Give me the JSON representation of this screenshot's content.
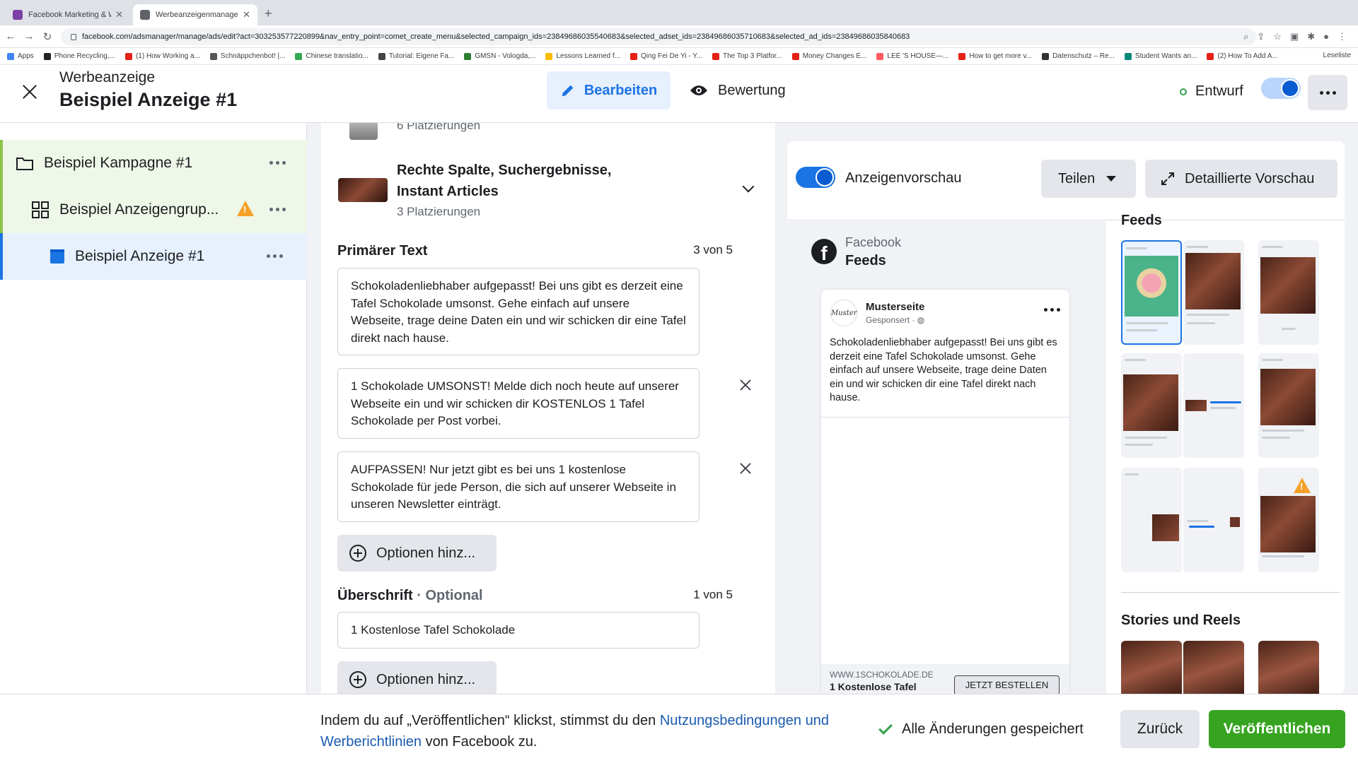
{
  "browser": {
    "tabs": [
      {
        "label": "Facebook Marketing & Werbe…"
      },
      {
        "label": "Werbeanzeigenmanager - We…"
      }
    ],
    "url": "facebook.com/adsmanager/manage/ads/edit?act=303253577220899&nav_entry_point=comet_create_menu&selected_campaign_ids=23849686035540683&selected_adset_ids=23849686035710683&selected_ad_ids=23849686035840683",
    "bookmarks": [
      "Apps",
      "Phone Recycling,...",
      "(1) How Working a...",
      "Schnäppchenbot! |...",
      "Chinese translatio...",
      "Tutorial: Eigene Fa...",
      "GMSN - Vologda,...",
      "Lessons Learned f...",
      "Qing Fei De Yi - Y...",
      "The Top 3 Platfor...",
      "Money Changes E...",
      "LEE 'S HOUSE—...",
      "How to get more v...",
      "Datenschutz – Re...",
      "Student Wants an...",
      "(2) How To Add A..."
    ],
    "reading_list": "Leseliste"
  },
  "header": {
    "subtitle": "Werbeanzeige",
    "title": "Beispiel Anzeige #1",
    "edit_label": "Bearbeiten",
    "review_label": "Bewertung",
    "status_label": "Entwurf"
  },
  "tree": {
    "campaign": "Beispiel Kampagne #1",
    "adset": "Beispiel Anzeigengrup...",
    "ad": "Beispiel Anzeige #1"
  },
  "editor": {
    "placement1_count": "6 Platzierungen",
    "placement2_title_line1": "Rechte Spalte, Suchergebnisse,",
    "placement2_title_line2": "Instant Articles",
    "placement2_count": "3 Platzierungen",
    "primary_title": "Primärer Text",
    "primary_count": "3 von 5",
    "primary_texts": [
      "Schokoladenliebhaber aufgepasst! Bei uns gibt es derzeit eine Tafel Schokolade umsonst. Gehe einfach auf unsere Webseite, trage deine Daten ein und wir schicken dir eine Tafel direkt nach hause.",
      "1 Schokolade UMSONST! Melde dich noch heute auf unserer Webseite ein und wir schicken dir KOSTENLOS 1 Tafel Schokolade per Post vorbei.",
      "AUFPASSEN! Nur jetzt gibt es bei uns 1 kostenlose Schokolade für jede Person, die sich auf unserer Webseite in unseren Newsletter einträgt."
    ],
    "add_options_label": "Optionen hinz...",
    "headline_title": "Überschrift",
    "headline_optional": "· Optional",
    "headline_count": "1 von 5",
    "headline_value": "1 Kostenlose Tafel Schokolade"
  },
  "preview": {
    "toggle_label": "Anzeigenvorschau",
    "share_label": "Teilen",
    "detailed_label": "Detaillierte Vorschau",
    "platform": "Facebook",
    "placement": "Feeds",
    "page_name": "Musterseite",
    "sponsored": "Gesponsert ·",
    "avatar_text": "Muster",
    "post_text": "Schokoladenliebhaber aufgepasst! Bei uns gibt es derzeit eine Tafel Schokolade umsonst. Gehe einfach auf unsere Webseite, trage deine Daten ein und wir schicken dir eine Tafel direkt nach hause.",
    "link_url": "WWW.1SCHOKOLADE.DE",
    "link_headline": "1 Kostenlose Tafel",
    "cta": "JETZT BESTELLEN",
    "feeds_section": "Feeds",
    "stories_section": "Stories und Reels"
  },
  "footer": {
    "text_before": "Indem du auf „Veröffentlichen“ klickst, stimmst du den ",
    "link": "Nutzungsbedingungen und Werberichtlinien",
    "text_after": " von Facebook zu.",
    "saved": "Alle Änderungen gespeichert",
    "back": "Zurück",
    "publish": "Veröffentlichen"
  },
  "colors": {
    "accent": "#1b74e4",
    "publish": "#36a420",
    "warning": "#f7a12a",
    "status_green": "#31a24c"
  }
}
